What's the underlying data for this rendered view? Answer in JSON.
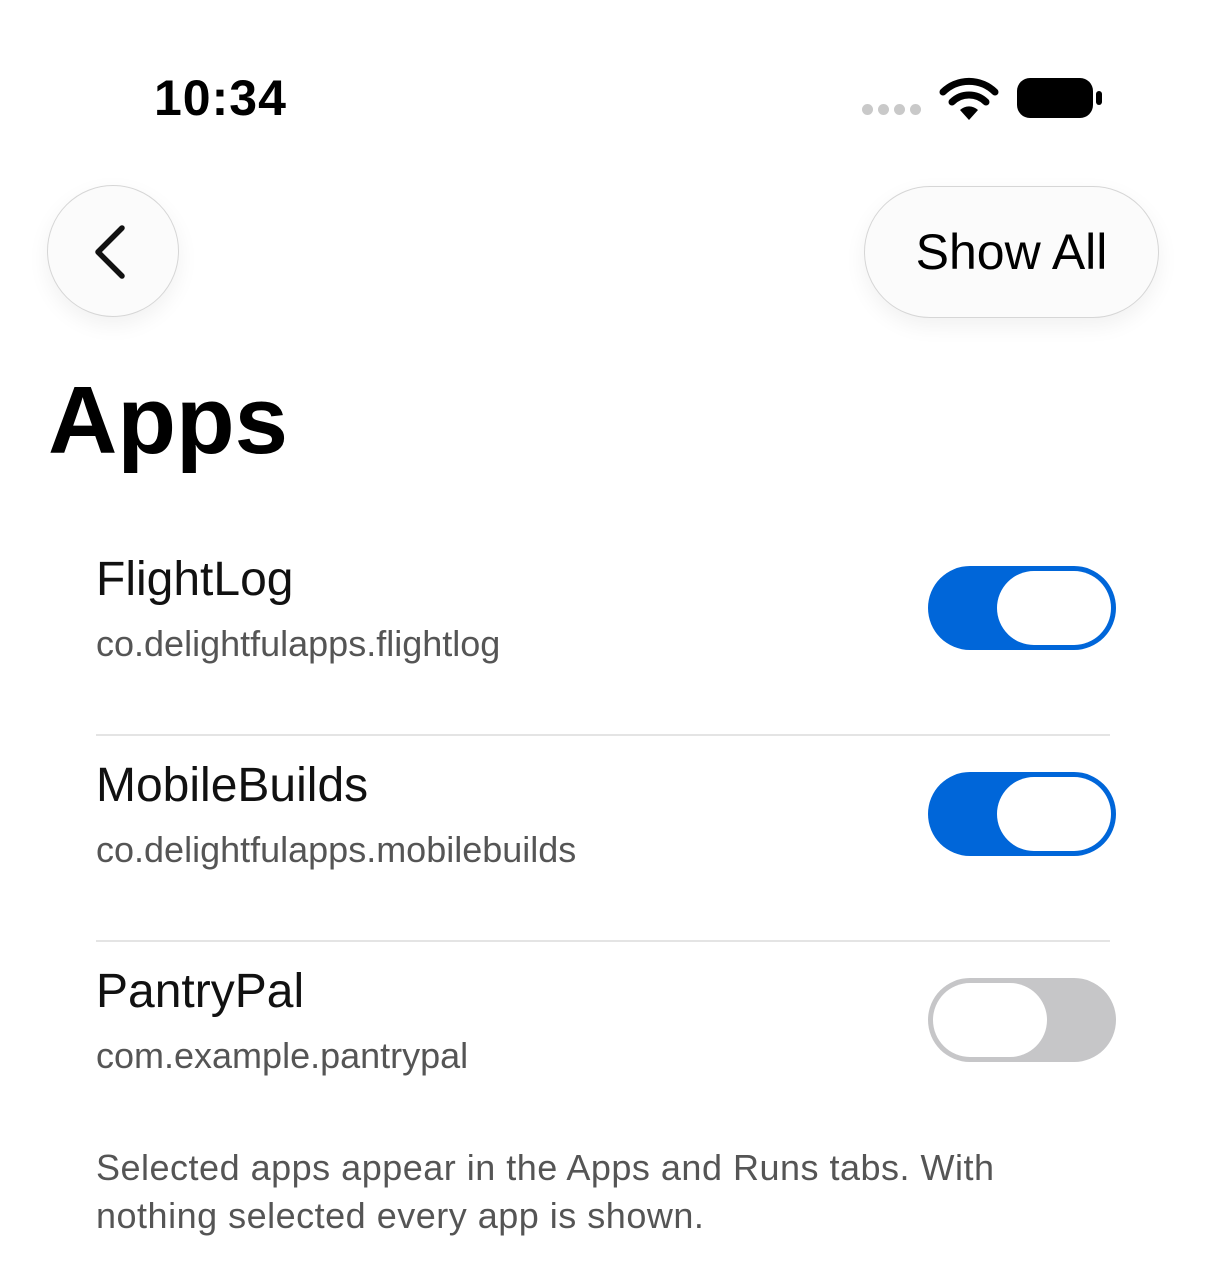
{
  "status_bar": {
    "time": "10:34",
    "signal_icon": "signal-dots-icon",
    "wifi_icon": "wifi-icon",
    "battery_icon": "battery-icon"
  },
  "nav": {
    "back_icon": "chevron-left-icon",
    "show_all_label": "Show All"
  },
  "page": {
    "title": "Apps"
  },
  "apps": [
    {
      "name": "FlightLog",
      "bundle_id": "co.delightfulapps.flightlog",
      "enabled": true
    },
    {
      "name": "MobileBuilds",
      "bundle_id": "co.delightfulapps.mobilebuilds",
      "enabled": true
    },
    {
      "name": "PantryPal",
      "bundle_id": "com.example.pantrypal",
      "enabled": false
    }
  ],
  "footer": {
    "note": "Selected apps appear in the Apps and Runs tabs. With nothing selected every app is shown."
  },
  "colors": {
    "toggle_on": "#0066d9",
    "toggle_off": "#c6c6c8",
    "secondary_text": "#555555"
  }
}
